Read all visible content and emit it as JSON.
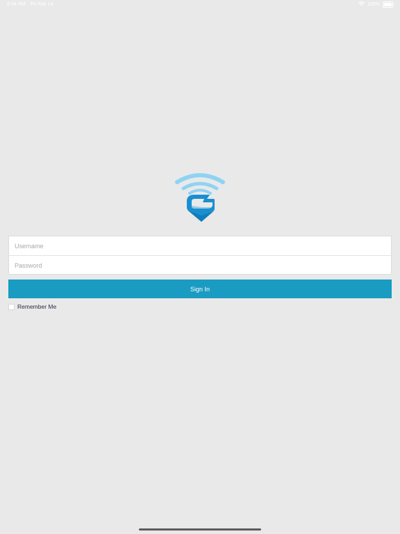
{
  "status_bar": {
    "time": "8:34 PM",
    "date": "Fri Feb 14",
    "battery": "100%",
    "wifi_icon": "wifi-icon",
    "battery_icon": "battery-icon"
  },
  "logo": {
    "icon": "g-wifi-pin-logo",
    "colors": {
      "signal": "#8fd3f4",
      "mark": "#1a8fd0"
    }
  },
  "login": {
    "username_placeholder": "Username",
    "password_placeholder": "Password",
    "sign_in_label": "Sign In",
    "remember_label": "Remember Me",
    "remember_checked": false
  },
  "colors": {
    "background": "#e9e9e9",
    "accent": "#1a9bc2"
  }
}
